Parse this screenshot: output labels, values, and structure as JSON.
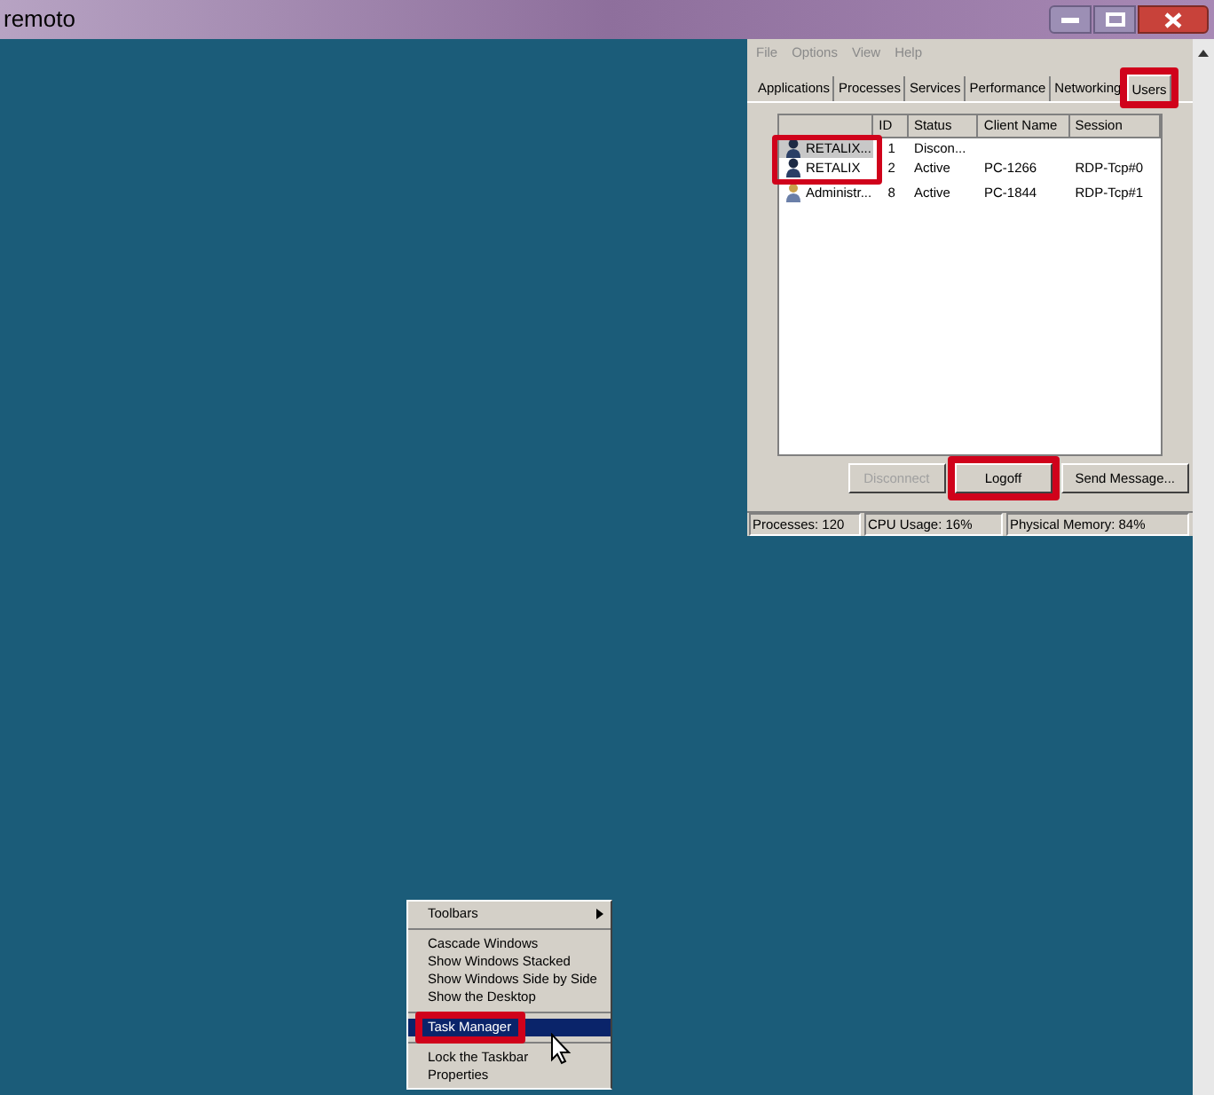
{
  "window": {
    "title": "remoto"
  },
  "task_manager": {
    "menu": [
      "File",
      "Options",
      "View",
      "Help"
    ],
    "tabs": [
      {
        "label": "Applications",
        "selected": false,
        "highlighted": false
      },
      {
        "label": "Processes",
        "selected": false,
        "highlighted": false
      },
      {
        "label": "Services",
        "selected": false,
        "highlighted": false
      },
      {
        "label": "Performance",
        "selected": false,
        "highlighted": false
      },
      {
        "label": "Networking",
        "selected": false,
        "highlighted": false
      },
      {
        "label": "Users",
        "selected": true,
        "highlighted": true
      }
    ],
    "columns": [
      "ID",
      "Status",
      "Client Name",
      "Session"
    ],
    "name_highlight": true,
    "rows": [
      {
        "kind": "user",
        "user": "RETALIX...",
        "id": "1",
        "status": "Discon...",
        "selected": true
      },
      {
        "kind": "user",
        "user": "RETALIX",
        "id": "2",
        "status": "Active",
        "client": "PC-1266",
        "session": "RDP-Tcp#0",
        "selected": false
      },
      {
        "kind": "admin",
        "user": "Administr...",
        "id": "8",
        "status": "Active",
        "client": "PC-1844",
        "session": "RDP-Tcp#1",
        "selected": false
      }
    ],
    "buttons": [
      {
        "label": "Disconnect",
        "disabled": true,
        "highlighted": false
      },
      {
        "label": "Logoff",
        "disabled": false,
        "highlighted": true
      },
      {
        "label": "Send Message...",
        "disabled": false,
        "highlighted": false
      }
    ],
    "status_bar": [
      "Processes: 120",
      "CPU Usage: 16%",
      "Physical Memory: 84%"
    ]
  },
  "context_menu": {
    "groups": [
      [
        {
          "label": "Toolbars",
          "submenu": true,
          "selected": false,
          "highlighted": false
        }
      ],
      [
        {
          "label": "Cascade Windows",
          "submenu": false,
          "selected": false,
          "highlighted": false
        },
        {
          "label": "Show Windows Stacked",
          "submenu": false,
          "selected": false,
          "highlighted": false
        },
        {
          "label": "Show Windows Side by Side",
          "submenu": false,
          "selected": false,
          "highlighted": false
        },
        {
          "label": "Show the Desktop",
          "submenu": false,
          "selected": false,
          "highlighted": false
        }
      ],
      [
        {
          "label": "Task Manager",
          "submenu": false,
          "selected": true,
          "highlighted": true
        }
      ],
      [
        {
          "label": "Lock the Taskbar",
          "submenu": false,
          "selected": false,
          "highlighted": false
        },
        {
          "label": "Properties",
          "submenu": false,
          "selected": false,
          "highlighted": false
        }
      ]
    ]
  }
}
